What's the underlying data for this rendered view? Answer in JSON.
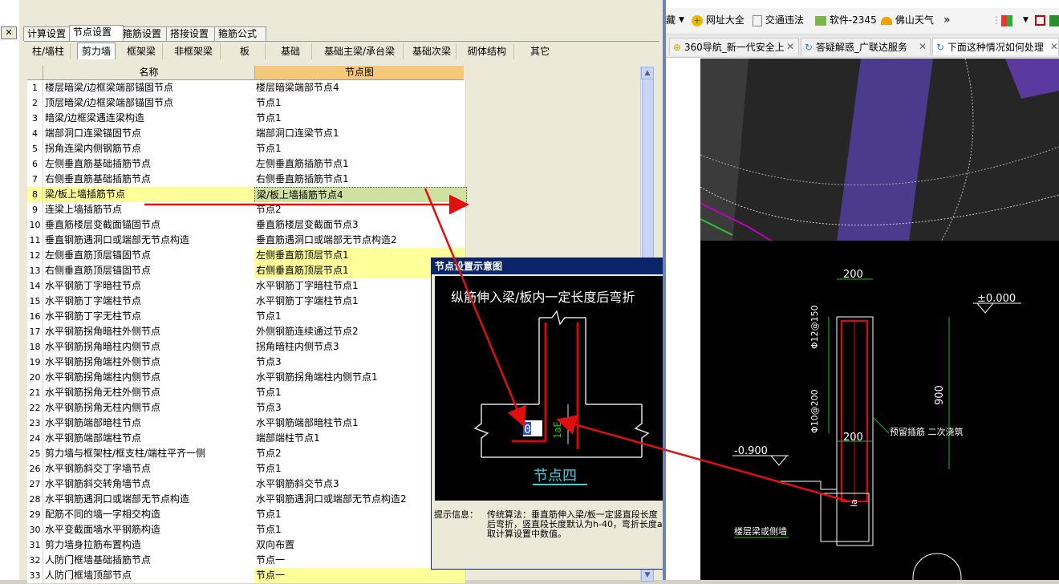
{
  "left_strip": {
    "close_glyph": "✕"
  },
  "main_tabs": [
    "计算设置",
    "节点设置",
    "箍筋设置",
    "搭接设置",
    "箍筋公式"
  ],
  "sub_tabs": [
    "柱/墙柱",
    "剪力墙",
    "框架梁",
    "非框架梁",
    "板",
    "基础",
    "基础主梁/承台梁",
    "基础次梁",
    "砌体结构",
    "其它"
  ],
  "grid": {
    "headers": [
      "名称",
      "节点图"
    ],
    "rows": [
      {
        "n": "1",
        "name": "楼层暗梁/边框梁端部锚固节点",
        "node": "楼层暗梁端部节点4"
      },
      {
        "n": "2",
        "name": "顶层暗梁/边框梁端部锚固节点",
        "node": "节点1"
      },
      {
        "n": "3",
        "name": "暗梁/边框梁遇连梁构造",
        "node": "节点1"
      },
      {
        "n": "4",
        "name": "端部洞口连梁锚固节点",
        "node": "端部洞口连梁节点1"
      },
      {
        "n": "5",
        "name": "拐角连梁内侧钢筋节点",
        "node": "节点1"
      },
      {
        "n": "6",
        "name": "左侧垂直筋基础插筋节点",
        "node": "左侧垂直筋插筋节点1"
      },
      {
        "n": "7",
        "name": "右侧垂直筋基础插筋节点",
        "node": "右侧垂直筋插筋节点1"
      },
      {
        "n": "8",
        "name": "梁/板上墙插筋节点",
        "node": "梁/板上墙插筋节点4"
      },
      {
        "n": "9",
        "name": "连梁上墙插筋节点",
        "node": "节点2"
      },
      {
        "n": "10",
        "name": "垂直筋楼层变截面锚固节点",
        "node": "垂直筋楼层变截面节点3"
      },
      {
        "n": "11",
        "name": "垂直钢筋遇洞口或端部无节点构造",
        "node": "垂直筋遇洞口或端部无节点构造2"
      },
      {
        "n": "12",
        "name": "左侧垂直筋顶层锚固节点",
        "node": "左侧垂直筋顶层节点1"
      },
      {
        "n": "13",
        "name": "右侧垂直筋顶层锚固节点",
        "node": "右侧垂直筋顶层节点1"
      },
      {
        "n": "14",
        "name": "水平钢筋丁字暗柱节点",
        "node": "水平钢筋丁字暗柱节点1"
      },
      {
        "n": "15",
        "name": "水平钢筋丁字端柱节点",
        "node": "水平钢筋丁字端柱节点1"
      },
      {
        "n": "16",
        "name": "水平钢筋丁字无柱节点",
        "node": "节点1"
      },
      {
        "n": "17",
        "name": "水平钢筋拐角暗柱外侧节点",
        "node": "外侧钢筋连续通过节点2"
      },
      {
        "n": "18",
        "name": "水平钢筋拐角暗柱内侧节点",
        "node": "拐角暗柱内侧节点3"
      },
      {
        "n": "19",
        "name": "水平钢筋拐角端柱外侧节点",
        "node": "节点3"
      },
      {
        "n": "20",
        "name": "水平钢筋拐角端柱内侧节点",
        "node": "水平钢筋拐角端柱内侧节点1"
      },
      {
        "n": "21",
        "name": "水平钢筋拐角无柱外侧节点",
        "node": "节点1"
      },
      {
        "n": "22",
        "name": "水平钢筋拐角无柱内侧节点",
        "node": "节点3"
      },
      {
        "n": "23",
        "name": "水平钢筋端部暗柱节点",
        "node": "水平钢筋端部暗柱节点1"
      },
      {
        "n": "24",
        "name": "水平钢筋端部端柱节点",
        "node": "端部端柱节点1"
      },
      {
        "n": "25",
        "name": "剪力墙与框架柱/框支柱/端柱平齐一侧",
        "node": "节点2"
      },
      {
        "n": "26",
        "name": "水平钢筋斜交丁字墙节点",
        "node": "节点1"
      },
      {
        "n": "27",
        "name": "水平钢筋斜交转角墙节点",
        "node": "水平钢筋斜交节点3"
      },
      {
        "n": "28",
        "name": "水平钢筋遇洞口或端部无节点构造",
        "node": "水平钢筋遇洞口或端部无节点构造2"
      },
      {
        "n": "29",
        "name": "配筋不同的墙一字相交构造",
        "node": "节点1"
      },
      {
        "n": "30",
        "name": "水平变截面墙水平钢筋构造",
        "node": "节点1"
      },
      {
        "n": "31",
        "name": "剪力墙身拉筋布置构造",
        "node": "双向布置"
      },
      {
        "n": "32",
        "name": "人防门框墙基础插筋节点",
        "node": "节点一"
      },
      {
        "n": "33",
        "name": "人防门框墙顶部节点",
        "node": "节点一"
      }
    ],
    "selected_row": "8",
    "highlighted_rows": [
      "12",
      "13",
      "33"
    ]
  },
  "dialog": {
    "title": "节点设置示意图",
    "caption": "纵筋伸入梁/板内一定长度后弯折",
    "value": "0",
    "dim_label": "1aE",
    "node_label": "节点四",
    "hint_label": "提示信息：",
    "hint_text": "传统算法：垂直筋伸入梁/板一定竖直段长度后弯折，竖直段长度默认为h-40，弯折长度a取计算设置中数值。"
  },
  "browser": {
    "toolbar": [
      {
        "icon": "star-icon",
        "label": "藏"
      },
      {
        "icon": "chevron-down-icon",
        "label": ""
      },
      {
        "icon": "360-icon",
        "label": "网址大全"
      },
      {
        "icon": "doc-icon",
        "label": "交通违法"
      },
      {
        "icon": "soft-icon",
        "label": "软件-2345"
      },
      {
        "icon": "weather-icon",
        "label": "佛山天气"
      },
      {
        "icon": "more-icon",
        "label": "»"
      }
    ],
    "tabs": [
      {
        "label": "360导航_新一代安全上",
        "active": false
      },
      {
        "label": "答疑解惑_广联达服务",
        "active": false
      },
      {
        "label": "下面这种情况如何处理",
        "active": true
      }
    ],
    "cad_labels": {
      "dim_top": "200",
      "level_top": "±0.000",
      "rebar1": "Φ12@150",
      "rebar2": "Φ10@200",
      "dim_mid": "200",
      "height": "900",
      "note": "预留插筋 二次浇筑",
      "level_low": "-0.900",
      "la": "la",
      "floor": "楼层梁或侧墙"
    }
  },
  "colors": {
    "selected_row": "#cfe0a0",
    "highlight": "#ffff99",
    "header_node": "#f6c97a",
    "arrow": "#e01010"
  }
}
